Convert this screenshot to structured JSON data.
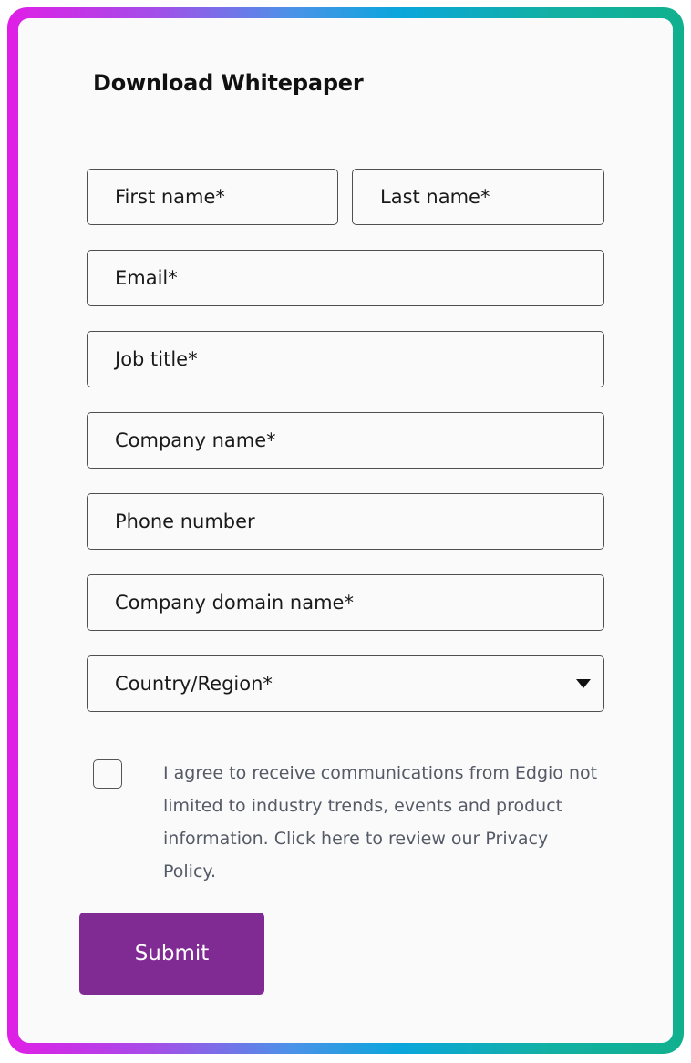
{
  "form": {
    "title": "Download Whitepaper",
    "fields": {
      "first_name": "First name*",
      "last_name": "Last name*",
      "email": "Email*",
      "job_title": "Job title*",
      "company_name": "Company name*",
      "phone_number": "Phone number",
      "company_domain": "Company domain name*",
      "country_region": "Country/Region*"
    },
    "consent_text": "I agree to receive communications from Edgio not limited to industry trends, events and product information. Click here to review our Privacy Policy.",
    "consent_checked": false,
    "submit_label": "Submit"
  },
  "icons": {
    "country_dropdown": "caret-down-icon"
  },
  "colors": {
    "gradient": [
      "#e01ee6",
      "#a34fe8",
      "#4b92e8",
      "#0aa6dc",
      "#12b0a4",
      "#10b08e"
    ],
    "submit_button": "#802a94",
    "card_background": "#fafafa",
    "consent_text": "#545a66"
  }
}
